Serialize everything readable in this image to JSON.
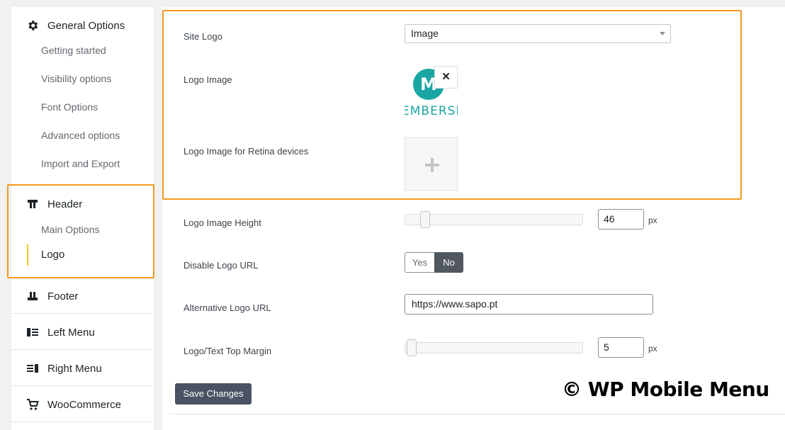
{
  "sidebar": {
    "general": {
      "title": "General Options",
      "icon": "gear-icon",
      "items": [
        {
          "label": "Getting started"
        },
        {
          "label": "Visibility options"
        },
        {
          "label": "Font Options"
        },
        {
          "label": "Advanced options"
        },
        {
          "label": "Import and Export"
        }
      ]
    },
    "header": {
      "title": "Header",
      "icon": "header-icon",
      "items": [
        {
          "label": "Main Options"
        },
        {
          "label": "Logo"
        }
      ],
      "active_item": "Logo"
    },
    "footer": {
      "title": "Footer",
      "icon": "footer-icon"
    },
    "left_menu": {
      "title": "Left Menu",
      "icon": "left-menu-icon"
    },
    "right_menu": {
      "title": "Right Menu",
      "icon": "right-menu-icon"
    },
    "woocommerce": {
      "title": "WooCommerce",
      "icon": "cart-icon"
    }
  },
  "form": {
    "site_logo": {
      "label": "Site Logo",
      "value": "Image"
    },
    "logo_image": {
      "label": "Logo Image",
      "preview_letter": "M",
      "preview_text": "EMBERSHI"
    },
    "logo_retina": {
      "label": "Logo Image for Retina devices"
    },
    "logo_height": {
      "label": "Logo Image Height",
      "value": "46",
      "unit": "px",
      "slider_fraction": 0.08
    },
    "disable_url": {
      "label": "Disable Logo URL",
      "options": [
        "Yes",
        "No"
      ],
      "selected": "No"
    },
    "alt_url": {
      "label": "Alternative Logo URL",
      "value": "https://www.sapo.pt"
    },
    "top_margin": {
      "label": "Logo/Text Top Margin",
      "value": "5",
      "unit": "px",
      "slider_fraction": 0.0
    }
  },
  "actions": {
    "save_label": "Save Changes"
  },
  "watermark": "© WP Mobile Menu",
  "colors": {
    "highlight": "#f39a1e",
    "active_bar": "#f5c518",
    "button_dark": "#4a5363",
    "logo_teal": "#1aa6a2"
  }
}
